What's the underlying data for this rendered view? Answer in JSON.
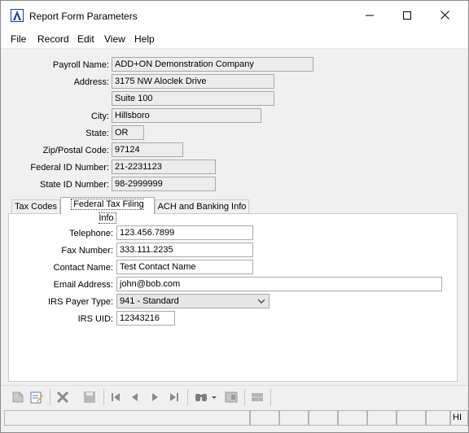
{
  "window": {
    "title": "Report Form Parameters"
  },
  "menu": [
    "File",
    "Record",
    "Edit",
    "View",
    "Help"
  ],
  "company": {
    "payroll_name_label": "Payroll Name:",
    "payroll_name": "ADD+ON Demonstration Company",
    "address_label": "Address:",
    "address1": "3175 NW Aloclek Drive",
    "address2": "Suite 100",
    "city_label": "City:",
    "city": "Hillsboro",
    "state_label": "State:",
    "state": "OR",
    "zip_label": "Zip/Postal Code:",
    "zip": "97124",
    "federal_id_label": "Federal ID Number:",
    "federal_id": "21-2231123",
    "state_id_label": "State ID Number:",
    "state_id": "98-2999999"
  },
  "tabs": [
    "Tax Codes",
    "Federal Tax Filing Info",
    "ACH and Banking Info"
  ],
  "active_tab_index": 1,
  "filing": {
    "telephone_label": "Telephone:",
    "telephone": "123.456.7899",
    "fax_label": "Fax Number:",
    "fax": "333.111.2235",
    "contact_label": "Contact Name:",
    "contact": "Test Contact Name",
    "email_label": "Email Address:",
    "email": "john@bob.com",
    "payer_type_label": "IRS Payer Type:",
    "payer_type": "941 - Standard",
    "irs_uid_label": "IRS UID:",
    "irs_uid": "12343216"
  },
  "toolbar_icons": [
    "new-record-icon",
    "edit-form-icon",
    "delete-icon",
    "save-icon",
    "first-record-icon",
    "previous-record-icon",
    "next-record-icon",
    "last-record-icon",
    "find-icon",
    "find-dropdown-icon",
    "lookup-icon",
    "list-icon"
  ],
  "status": {
    "indicator": "HI"
  },
  "colors": {
    "accent": "#1f3f8f",
    "window_bg": "#f0f0f0",
    "field_bg": "#ececec"
  }
}
